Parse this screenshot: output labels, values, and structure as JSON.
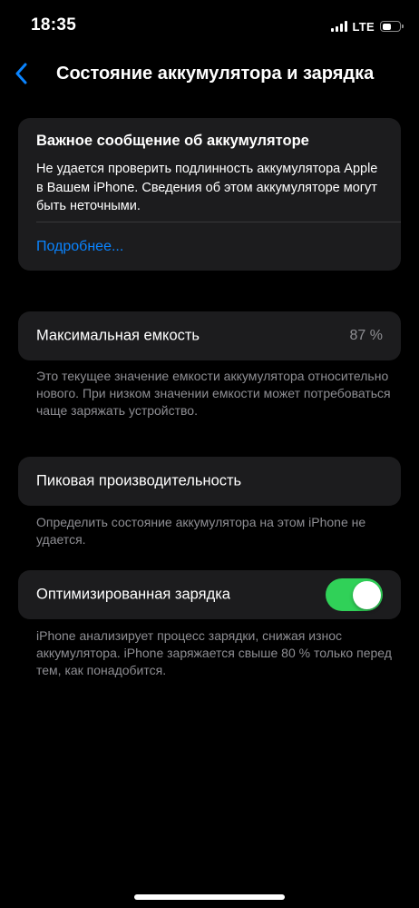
{
  "status_bar": {
    "time": "18:35",
    "network": "LTE",
    "battery_level": 0.55
  },
  "nav": {
    "back_icon": "chevron-left-icon",
    "title": "Состояние аккумулятора и зарядка"
  },
  "alert": {
    "title": "Важное сообщение об аккумуляторе",
    "body": "Не удается проверить подлинность аккумулятора Apple в Вашем iPhone. Сведения об этом аккуму­ляторе могут быть неточными.",
    "link": "Подробнее..."
  },
  "capacity": {
    "label": "Максимальная емкость",
    "value": "87 %",
    "footnote": "Это текущее значение емкости аккумулятора относительно нового. При низком значении емкости может потребоваться чаще заряжать устройство."
  },
  "peak": {
    "label": "Пиковая производительность",
    "footnote": "Определить состояние аккумулятора на этом iPhone не удается."
  },
  "optimized": {
    "label": "Оптимизированная зарядка",
    "enabled": true,
    "footnote": "iPhone анализирует процесс зарядки, снижая износ аккумулятора. iPhone заряжается свыше 80 % только перед тем, как понадобится."
  },
  "colors": {
    "background": "#000000",
    "card": "#1c1c1e",
    "accent": "#0a84ff",
    "toggle_on": "#30d158",
    "secondary_text": "#8e8e93"
  }
}
